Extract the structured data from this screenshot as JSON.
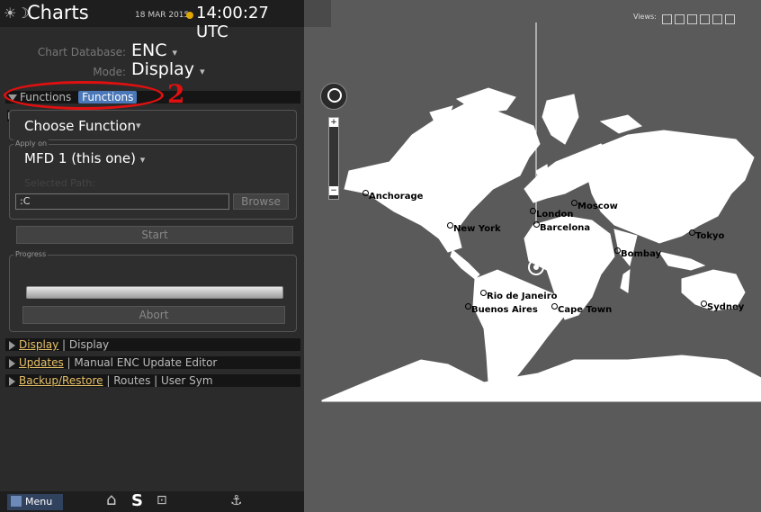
{
  "header": {
    "title": "Charts",
    "date": "18 MAR 2015",
    "time": "14:00:27 UTC"
  },
  "chart_database": {
    "label": "Chart Database:",
    "value": "ENC"
  },
  "mode": {
    "label": "Mode:",
    "value": "Display"
  },
  "functions_section": {
    "header_label": "Functions",
    "tab_label": "Functions",
    "annotation_number": "2",
    "choose_function": "Choose Function",
    "apply_on_legend": "Apply on",
    "apply_on_value": "MFD 1 (this one)",
    "selected_path_label": "Selected Path:",
    "path_value": ":C",
    "browse_label": "Browse",
    "start_label": "Start",
    "progress_legend": "Progress",
    "progress": 0,
    "abort_label": "Abort"
  },
  "sections": [
    {
      "highlight": "Display",
      "rest": " | Display"
    },
    {
      "highlight": "Updates",
      "rest": " | Manual ENC Update Editor"
    },
    {
      "highlight": "Backup/Restore",
      "rest": " | Routes | User Sym"
    }
  ],
  "bottom_bar": {
    "menu_label": "Menu"
  },
  "views_label": "Views:",
  "cities": [
    "Anchorage",
    "London",
    "Moscow",
    "New York",
    "Barcelona",
    "Tokyo",
    "Bombay",
    "Rio de Janeiro",
    "Buenos Aires",
    "Cape Town",
    "Sydney"
  ],
  "colors": {
    "annotation_red": "#e01010",
    "tab_blue": "#4a78b8",
    "highlight": "#e8c16a"
  }
}
